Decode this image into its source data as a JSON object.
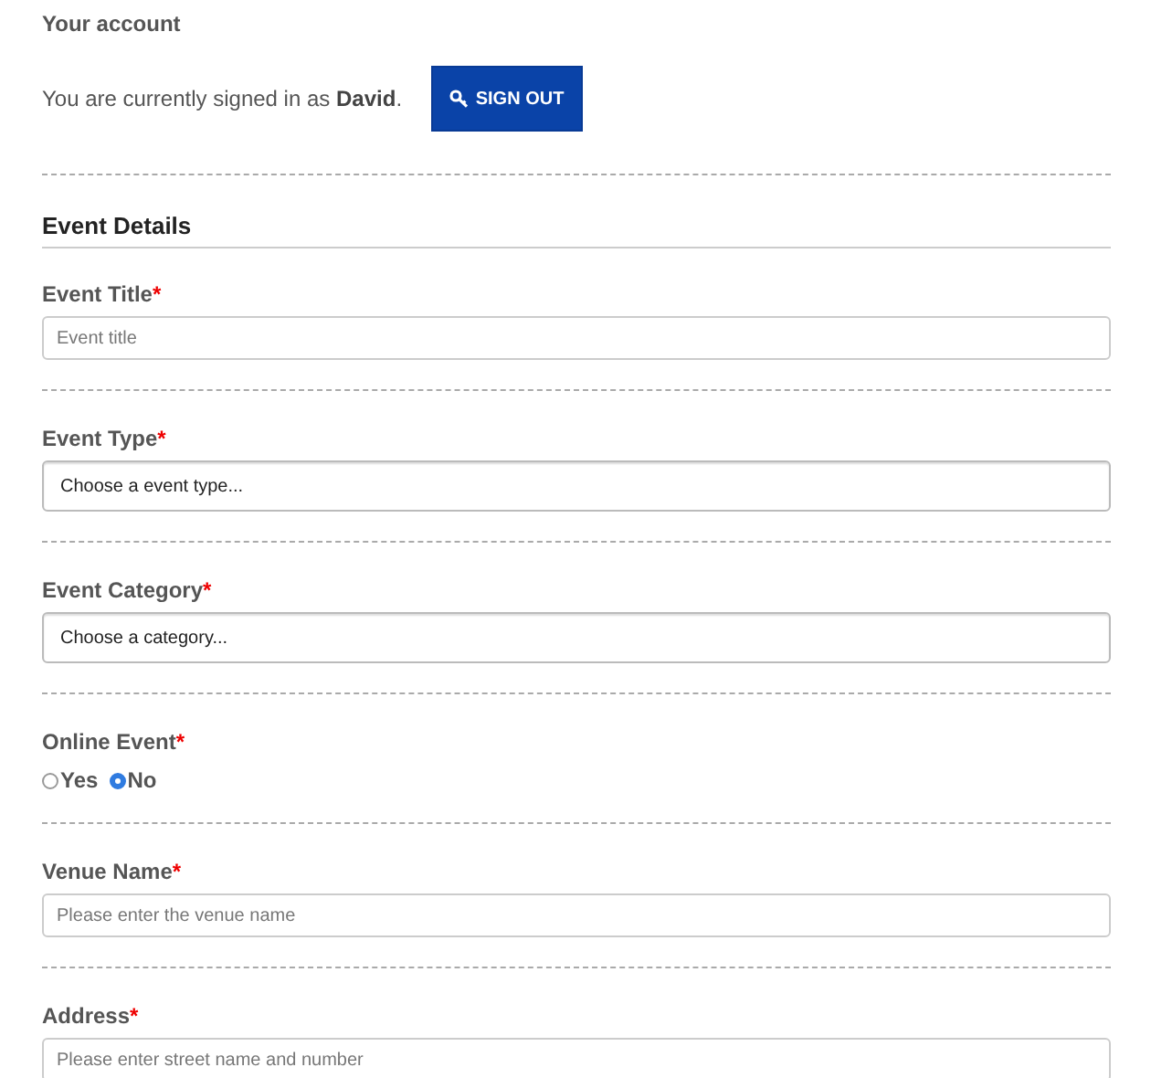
{
  "account": {
    "heading": "Your account",
    "signed_in_text": "You are currently signed in as **David**.",
    "sign_out_button": "SIGN OUT"
  },
  "section_title": "Event Details",
  "fields": [
    {
      "kind": "text",
      "label": "Event Title",
      "required_mark": "*",
      "placeholder": "Event title"
    },
    {
      "kind": "select",
      "label": "Event Type",
      "required_mark": "*",
      "value": "Choose a event type..."
    },
    {
      "kind": "select",
      "label": "Event Category",
      "required_mark": "*",
      "value": "Choose a category..."
    },
    {
      "kind": "radio",
      "label": "Online Event",
      "required_mark": "*",
      "options": [
        {
          "label": "Yes",
          "selected": false
        },
        {
          "label": "No",
          "selected": true
        }
      ]
    },
    {
      "kind": "text",
      "label": "Venue Name",
      "required_mark": "*",
      "placeholder": "Please enter the venue name"
    },
    {
      "kind": "text",
      "label": "Address",
      "required_mark": "*",
      "placeholder": "Please enter street name and number"
    }
  ]
}
